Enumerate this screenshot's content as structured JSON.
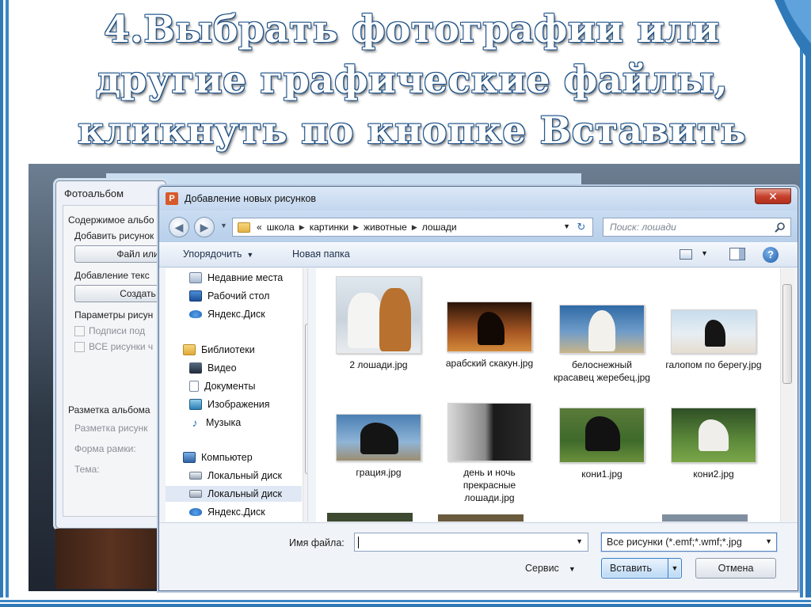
{
  "slide": {
    "title_lines": [
      "4.Выбрать  фотографии или",
      "другие графические файлы,",
      "кликнуть по кнопке Вставить"
    ]
  },
  "album_dialog": {
    "title": "Фотоальбом",
    "content_label": "Содержимое альбо",
    "add_picture_label": "Добавить рисунок",
    "file_button": "Файл или",
    "add_text_label": "Добавление текс",
    "create_button": "Создать",
    "picture_params_label": "Параметры рисун",
    "captions_checkbox": "Подписи под",
    "all_pictures_checkbox": "ВСЕ рисунки ч",
    "layout_label": "Разметка альбома",
    "picture_layout": "Разметка рисунк",
    "frame_shape": "Форма рамки:",
    "theme": "Тема:"
  },
  "dialog": {
    "title": "Добавление новых рисунков",
    "close": "✕",
    "breadcrumb": [
      "«",
      "школа",
      "картинки",
      "животные",
      "лошади"
    ],
    "search_placeholder": "Поиск: лошади",
    "organize": "Упорядочить",
    "new_folder": "Новая папка",
    "help": "?",
    "nav": [
      {
        "label": "Недавние места",
        "icon": "recent-places-icon"
      },
      {
        "label": "Рабочий стол",
        "icon": "desktop-icon"
      },
      {
        "label": "Яндекс.Диск",
        "icon": "yandex-disk-icon"
      },
      {
        "label": "Библиотеки",
        "icon": "libraries-icon"
      },
      {
        "label": "Видео",
        "icon": "video-icon"
      },
      {
        "label": "Документы",
        "icon": "documents-icon"
      },
      {
        "label": "Изображения",
        "icon": "pictures-icon"
      },
      {
        "label": "Музыка",
        "icon": "music-icon"
      },
      {
        "label": "Компьютер",
        "icon": "computer-icon"
      },
      {
        "label": "Локальный диск",
        "icon": "local-disk-icon"
      },
      {
        "label": "Локальный диск",
        "icon": "local-disk-icon"
      },
      {
        "label": "Яндекс.Диск",
        "icon": "yandex-disk-icon"
      }
    ],
    "files": [
      {
        "name": "2 лошади.jpg"
      },
      {
        "name": "арабский скакун.jpg"
      },
      {
        "name": "белоснежный красавец жеребец.jpg"
      },
      {
        "name": "галопом по берегу.jpg"
      },
      {
        "name": "грация.jpg"
      },
      {
        "name": "день и ночь прекрасные лошади.jpg"
      },
      {
        "name": "кони1.jpg"
      },
      {
        "name": "кони2.jpg"
      }
    ],
    "filename_label": "Имя файла:",
    "filename_value": "",
    "file_type": "Все рисунки (*.emf;*.wmf;*.jpg",
    "service": "Сервис",
    "insert": "Вставить",
    "cancel": "Отмена"
  }
}
